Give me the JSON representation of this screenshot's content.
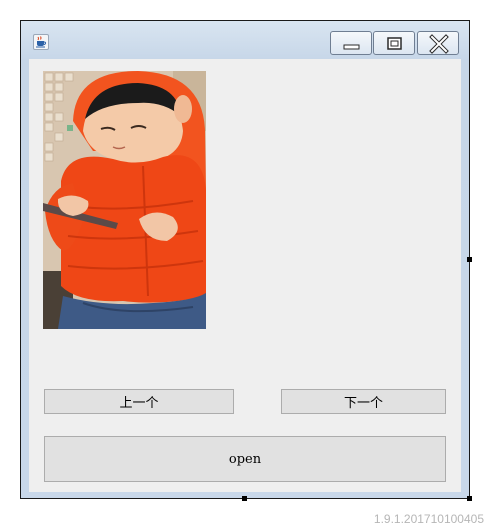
{
  "window": {
    "app_icon": "java-cup-icon",
    "controls": [
      "minimize-icon",
      "maximize-icon",
      "close-icon"
    ]
  },
  "viewer": {
    "photo": "child-in-red-jacket-photo",
    "prev_label": "上一个",
    "next_label": "下一个",
    "open_label": "open"
  },
  "footer": {
    "version": "1.9.1.201710100405"
  }
}
